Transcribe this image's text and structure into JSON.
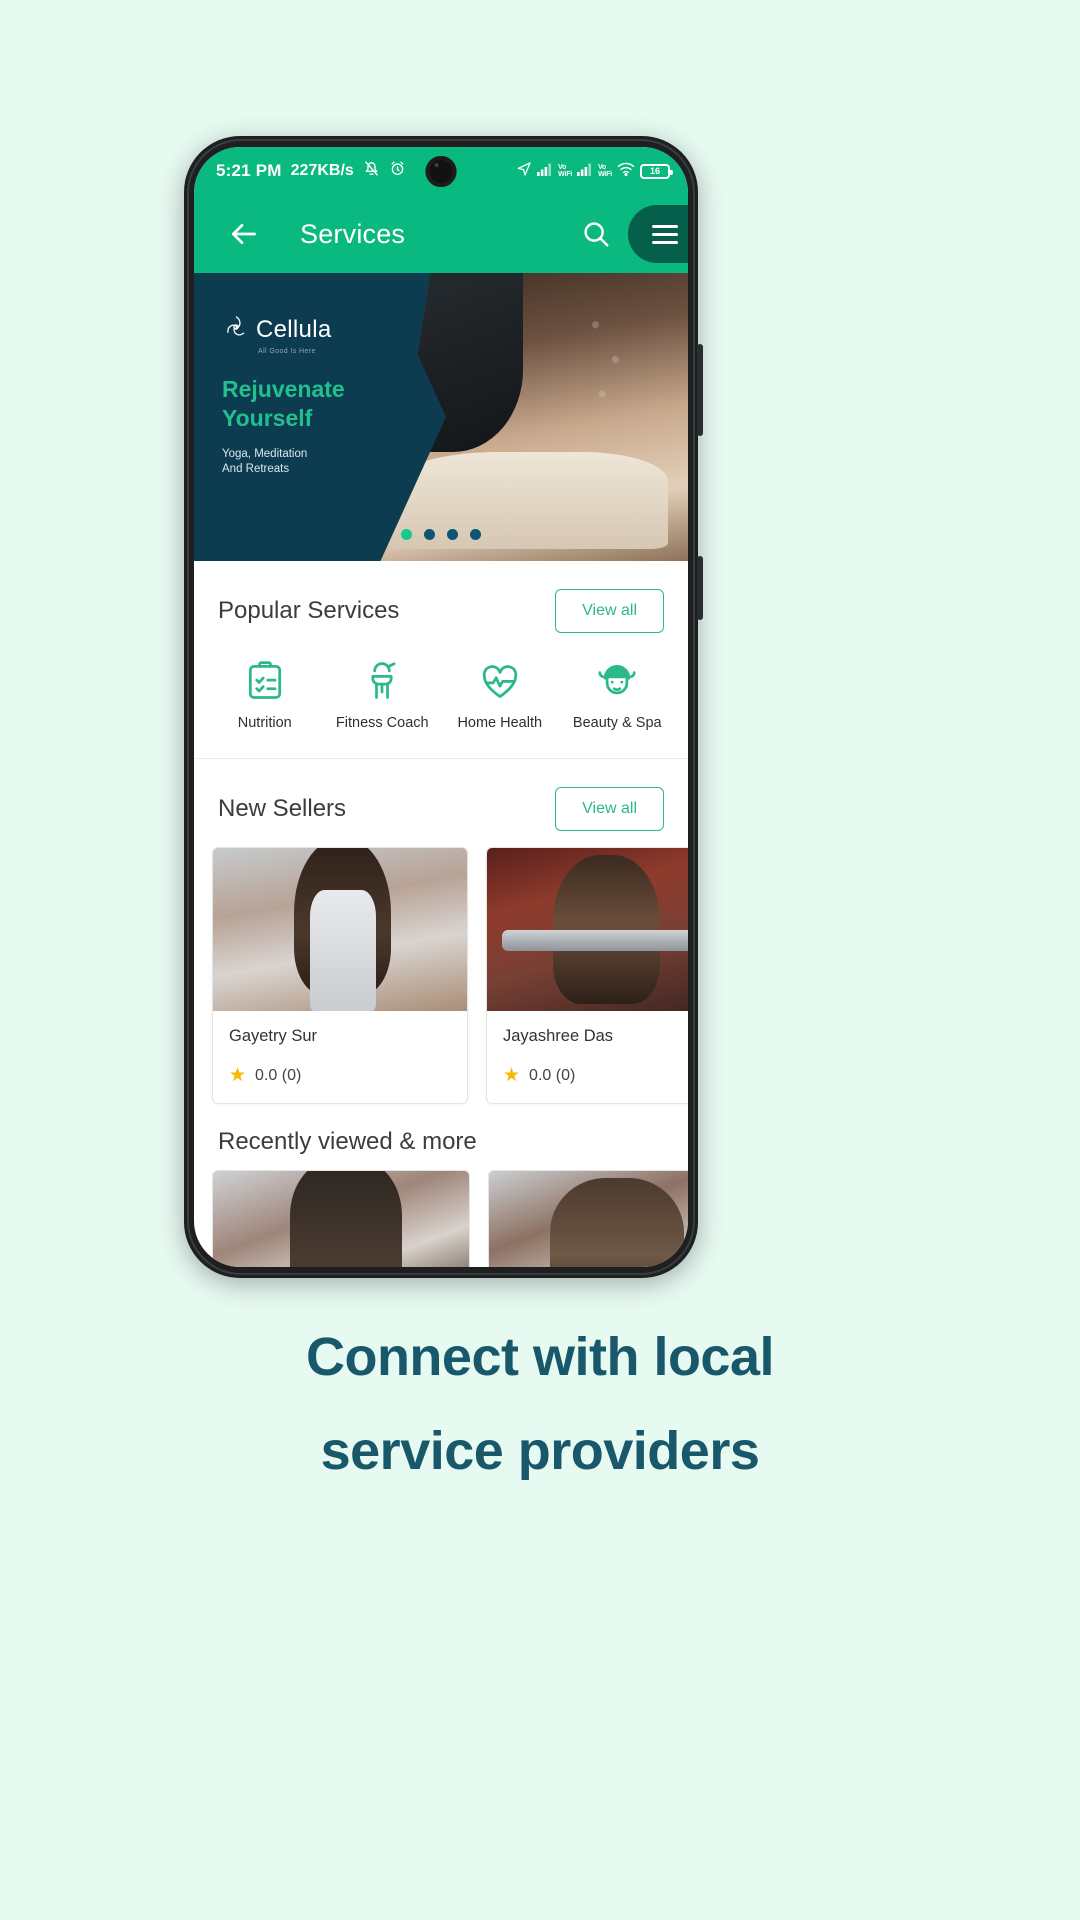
{
  "statusbar": {
    "time": "5:21 PM",
    "network_speed": "227KB/s",
    "icons": [
      "mute-bell-icon",
      "alarm-clock-icon",
      "location-arrow-icon",
      "signal-bars-icon",
      "vowifi-icon",
      "signal-bars-icon-2",
      "vowifi-icon-2",
      "wifi-icon"
    ],
    "vowifi_top": "Vo",
    "vowifi_bottom": "WiFi",
    "battery_level": "16"
  },
  "appbar": {
    "back_label": "back-arrow",
    "title": "Services",
    "search_label": "search",
    "menu_label": "menu",
    "bg_color": "#0ab97f",
    "menu_pill_color": "#055f4a"
  },
  "banner": {
    "brand": "Cellula",
    "brand_tagline": "All Good Is Here",
    "headline_line1": "Rejuvenate",
    "headline_line2": "Yourself",
    "subtitle_line1": "Yoga, Meditation",
    "subtitle_line2": "And Retreats",
    "bg_color": "#0d3c51",
    "headline_color": "#22c08e",
    "dots": 4,
    "active_dot": 0,
    "active_dot_color": "#17c98c",
    "inactive_dot_color": "#0d5571"
  },
  "popular_services": {
    "title": "Popular Services",
    "view_all": "View all",
    "items": [
      {
        "label": "Nutrition",
        "icon": "clipboard-check-icon"
      },
      {
        "label": "Fitness Coach",
        "icon": "coach-whistle-icon"
      },
      {
        "label": "Home Health",
        "icon": "heart-pulse-icon"
      },
      {
        "label": "Beauty & Spa",
        "icon": "spa-face-icon"
      }
    ]
  },
  "new_sellers": {
    "title": "New Sellers",
    "view_all": "View all",
    "cards": [
      {
        "name": "Gayetry Sur",
        "rating": "0.0 (0)",
        "photo": "female-fitness-trainer-photo"
      },
      {
        "name": "Jayashree Das",
        "rating": "0.0 (0)",
        "photo": "female-weightlifter-photo"
      }
    ]
  },
  "recently_viewed": {
    "title": "Recently viewed & more",
    "cards": [
      {
        "photo": "tattooed-man-gym-photo"
      },
      {
        "photo": "man-stretching-gym-photo"
      }
    ]
  },
  "caption": {
    "line1": "Connect with local",
    "line2": "service providers",
    "color": "#19586b"
  },
  "page": {
    "background": "#e6faf2"
  }
}
